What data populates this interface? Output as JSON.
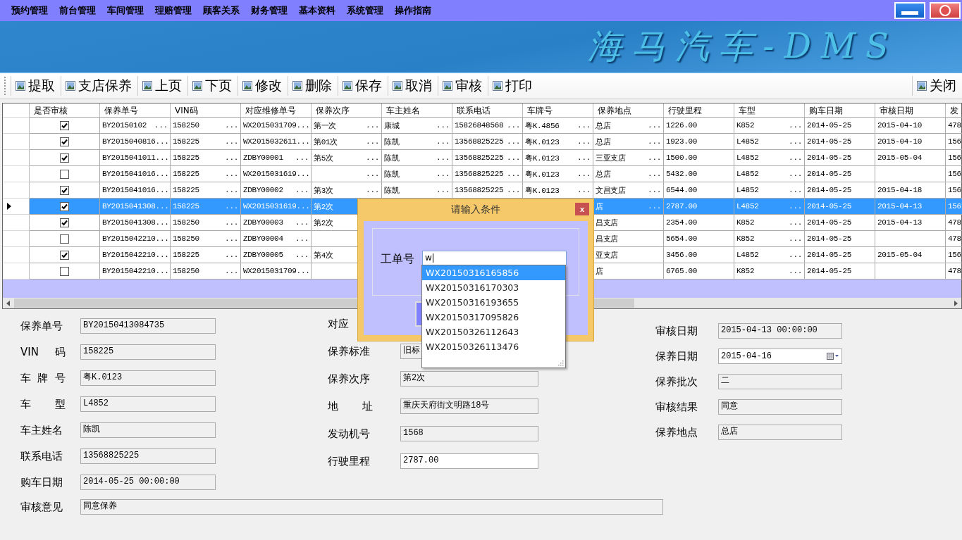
{
  "menu": [
    {
      "label": "预约管理"
    },
    {
      "label": "前台管理"
    },
    {
      "label": "车间管理"
    },
    {
      "label": "理赔管理"
    },
    {
      "label": "顾客关系"
    },
    {
      "label": "财务管理"
    },
    {
      "label": "基本资料"
    },
    {
      "label": "系统管理"
    },
    {
      "label": "操作指南"
    }
  ],
  "logo": "海马汽车-DMS",
  "toolbar": [
    {
      "label": "提取"
    },
    {
      "label": "支店保养"
    },
    {
      "label": "上页"
    },
    {
      "label": "下页"
    },
    {
      "label": "修改"
    },
    {
      "label": "删除"
    },
    {
      "label": "保存"
    },
    {
      "label": "取消"
    },
    {
      "label": "审核"
    },
    {
      "label": "打印"
    }
  ],
  "toolbar_right": {
    "label": "关闭"
  },
  "table": {
    "check_column": "是否审核",
    "columns": [
      "保养单号",
      "VIN码",
      "对应维修单号",
      "保养次序",
      "车主姓名",
      "联系电话",
      "车牌号",
      "保养地点",
      "行驶里程",
      "车型",
      "购车日期",
      "审核日期",
      "发"
    ],
    "rows": [
      {
        "selected": false,
        "checked": true,
        "cells": [
          {
            "text": "BY20150102",
            "tail": "..."
          },
          {
            "text": "158250",
            "tail": "..."
          },
          {
            "text": "WX2015031709..."
          },
          {
            "text": "第一次",
            "tail": "..."
          },
          {
            "text": "康城",
            "tail": "..."
          },
          {
            "text": "15826848568",
            "tail": "..."
          },
          {
            "text": "粤K.4856",
            "tail": "..."
          },
          {
            "text": "总店",
            "tail": "..."
          },
          {
            "text": "1226.00"
          },
          {
            "text": "K852",
            "tail": "..."
          },
          {
            "text": "2014-05-25"
          },
          {
            "text": "2015-04-10"
          },
          {
            "text": "478"
          }
        ]
      },
      {
        "selected": false,
        "checked": true,
        "cells": [
          {
            "text": "BY2015040816..."
          },
          {
            "text": "158225",
            "tail": "..."
          },
          {
            "text": "WX2015032611..."
          },
          {
            "text": "第01次",
            "tail": "..."
          },
          {
            "text": "陈凯",
            "tail": "..."
          },
          {
            "text": "13568825225",
            "tail": "..."
          },
          {
            "text": "粤K.0123",
            "tail": "..."
          },
          {
            "text": "总店",
            "tail": "..."
          },
          {
            "text": "1923.00"
          },
          {
            "text": "L4852",
            "tail": "..."
          },
          {
            "text": "2014-05-25"
          },
          {
            "text": "2015-04-10"
          },
          {
            "text": "156"
          }
        ]
      },
      {
        "selected": false,
        "checked": true,
        "cells": [
          {
            "text": "BY2015041011..."
          },
          {
            "text": "158225",
            "tail": "..."
          },
          {
            "text": "ZDBY00001",
            "tail": "..."
          },
          {
            "text": "第5次",
            "tail": "..."
          },
          {
            "text": "陈凯",
            "tail": "..."
          },
          {
            "text": "13568825225",
            "tail": "..."
          },
          {
            "text": "粤K.0123",
            "tail": "..."
          },
          {
            "text": "三亚支店",
            "tail": "..."
          },
          {
            "text": "1500.00"
          },
          {
            "text": "L4852",
            "tail": "..."
          },
          {
            "text": "2014-05-25"
          },
          {
            "text": "2015-05-04"
          },
          {
            "text": "156"
          }
        ]
      },
      {
        "selected": false,
        "checked": false,
        "cells": [
          {
            "text": "BY2015041016..."
          },
          {
            "text": "158225",
            "tail": "..."
          },
          {
            "text": "WX2015031619..."
          },
          {
            "tail": "..."
          },
          {
            "text": "陈凯",
            "tail": "..."
          },
          {
            "text": "13568825225",
            "tail": "..."
          },
          {
            "text": "粤K.0123",
            "tail": "..."
          },
          {
            "text": "总店",
            "tail": "..."
          },
          {
            "text": "5432.00"
          },
          {
            "text": "L4852",
            "tail": "..."
          },
          {
            "text": "2014-05-25"
          },
          {},
          {
            "text": "156"
          }
        ]
      },
      {
        "selected": false,
        "checked": true,
        "cells": [
          {
            "text": "BY2015041016..."
          },
          {
            "text": "158225",
            "tail": "..."
          },
          {
            "text": "ZDBY00002",
            "tail": "..."
          },
          {
            "text": "第3次",
            "tail": "..."
          },
          {
            "text": "陈凯",
            "tail": "..."
          },
          {
            "text": "13568825225",
            "tail": "..."
          },
          {
            "text": "粤K.0123",
            "tail": "..."
          },
          {
            "text": "文昌支店",
            "tail": "..."
          },
          {
            "text": "6544.00"
          },
          {
            "text": "L4852",
            "tail": "..."
          },
          {
            "text": "2014-05-25"
          },
          {
            "text": "2015-04-18"
          },
          {
            "text": "156"
          }
        ]
      },
      {
        "selected": true,
        "checked": true,
        "cells": [
          {
            "text": "BY2015041308..."
          },
          {
            "text": "158225",
            "tail": "..."
          },
          {
            "text": "WX2015031619..."
          },
          {
            "text": "第2次"
          },
          null,
          null,
          null,
          {
            "text": "店",
            "tail": "..."
          },
          {
            "text": "2787.00"
          },
          {
            "text": "L4852",
            "tail": "..."
          },
          {
            "text": "2014-05-25"
          },
          {
            "text": "2015-04-13"
          },
          {
            "text": "156"
          }
        ]
      },
      {
        "selected": false,
        "checked": true,
        "cells": [
          {
            "text": "BY2015041308..."
          },
          {
            "text": "158250",
            "tail": "..."
          },
          {
            "text": "ZDBY00003",
            "tail": "..."
          },
          {
            "text": "第2次"
          },
          null,
          null,
          null,
          {
            "text": "昌支店"
          },
          {
            "text": "2354.00"
          },
          {
            "text": "K852",
            "tail": "..."
          },
          {
            "text": "2014-05-25"
          },
          {
            "text": "2015-04-13"
          },
          {
            "text": "478"
          }
        ]
      },
      {
        "selected": false,
        "checked": false,
        "cells": [
          {
            "text": "BY2015042210..."
          },
          {
            "text": "158250",
            "tail": "..."
          },
          {
            "text": "ZDBY00004",
            "tail": "..."
          },
          {},
          null,
          null,
          null,
          {
            "text": "昌支店"
          },
          {
            "text": "5654.00"
          },
          {
            "text": "K852",
            "tail": "..."
          },
          {
            "text": "2014-05-25"
          },
          {},
          {
            "text": "478"
          }
        ]
      },
      {
        "selected": false,
        "checked": true,
        "cells": [
          {
            "text": "BY2015042210..."
          },
          {
            "text": "158225",
            "tail": "..."
          },
          {
            "text": "ZDBY00005",
            "tail": "..."
          },
          {
            "text": "第4次"
          },
          null,
          null,
          null,
          {
            "text": "亚支店"
          },
          {
            "text": "3456.00"
          },
          {
            "text": "L4852",
            "tail": "..."
          },
          {
            "text": "2014-05-25"
          },
          {
            "text": "2015-05-04"
          },
          {
            "text": "156"
          }
        ]
      },
      {
        "selected": false,
        "checked": false,
        "cells": [
          {
            "text": "BY2015042210..."
          },
          {
            "text": "158250",
            "tail": "..."
          },
          {
            "text": "WX2015031709..."
          },
          {},
          null,
          null,
          null,
          {
            "text": "店"
          },
          {
            "text": "6765.00"
          },
          {
            "text": "K852",
            "tail": "..."
          },
          {
            "text": "2014-05-25"
          },
          {},
          {
            "text": "478"
          }
        ]
      }
    ]
  },
  "form": {
    "left": [
      {
        "label": "保养单号",
        "value": "BY20150413084735",
        "editable": false
      },
      {
        "label": "VIN 码",
        "value": "158225",
        "editable": false,
        "kind": "spaced"
      },
      {
        "label": "车 牌 号",
        "value": "粤K.0123",
        "editable": false,
        "kind": "spaced"
      },
      {
        "label": "车 型",
        "value": "L4852",
        "editable": false,
        "kind": "spaced"
      },
      {
        "label": "车主姓名",
        "value": "陈凯",
        "editable": false
      },
      {
        "label": "联系电话",
        "value": "13568825225",
        "editable": false
      },
      {
        "label": "购车日期",
        "value": "2014-05-25 00:00:00",
        "editable": false
      }
    ],
    "middle": [
      {
        "label": "对应"
      },
      {
        "label": "保养标准",
        "value": "旧标",
        "editable": false,
        "kind": "covered"
      },
      {
        "label": "保养次序",
        "value": "第2次",
        "editable": false
      },
      {
        "label": "地 址",
        "value": "重庆天府街文明路18号",
        "editable": false,
        "kind": "spaced"
      },
      {
        "label": "发动机号",
        "value": "1568",
        "editable": false
      },
      {
        "label": "行驶里程",
        "value": "2787.00",
        "editable": true
      }
    ],
    "right": [
      {
        "label": "审核日期",
        "value": "2015-04-13 00:00:00",
        "editable": false
      },
      {
        "label": "保养日期",
        "value": "2015-04-16",
        "editable": true,
        "kind": "date"
      },
      {
        "label": "保养批次",
        "value": "二",
        "editable": false
      },
      {
        "label": "审核结果",
        "value": "同意",
        "editable": false
      },
      {
        "label": "保养地点",
        "value": "总店",
        "editable": false
      }
    ],
    "opinion": {
      "label": "审核意见",
      "value": "同意保养",
      "editable": false
    }
  },
  "dialog": {
    "title": "请输入条件",
    "close": "x",
    "label": "工单号",
    "value": "w",
    "suggestions": [
      {
        "text": "WX20150316165856",
        "selected": true
      },
      {
        "text": "WX20150316170303",
        "selected": false
      },
      {
        "text": "WX20150316193655",
        "selected": false
      },
      {
        "text": "WX20150317095826",
        "selected": false
      },
      {
        "text": "WX20150326112643",
        "selected": false
      },
      {
        "text": "WX20150326113476",
        "selected": false
      }
    ]
  }
}
